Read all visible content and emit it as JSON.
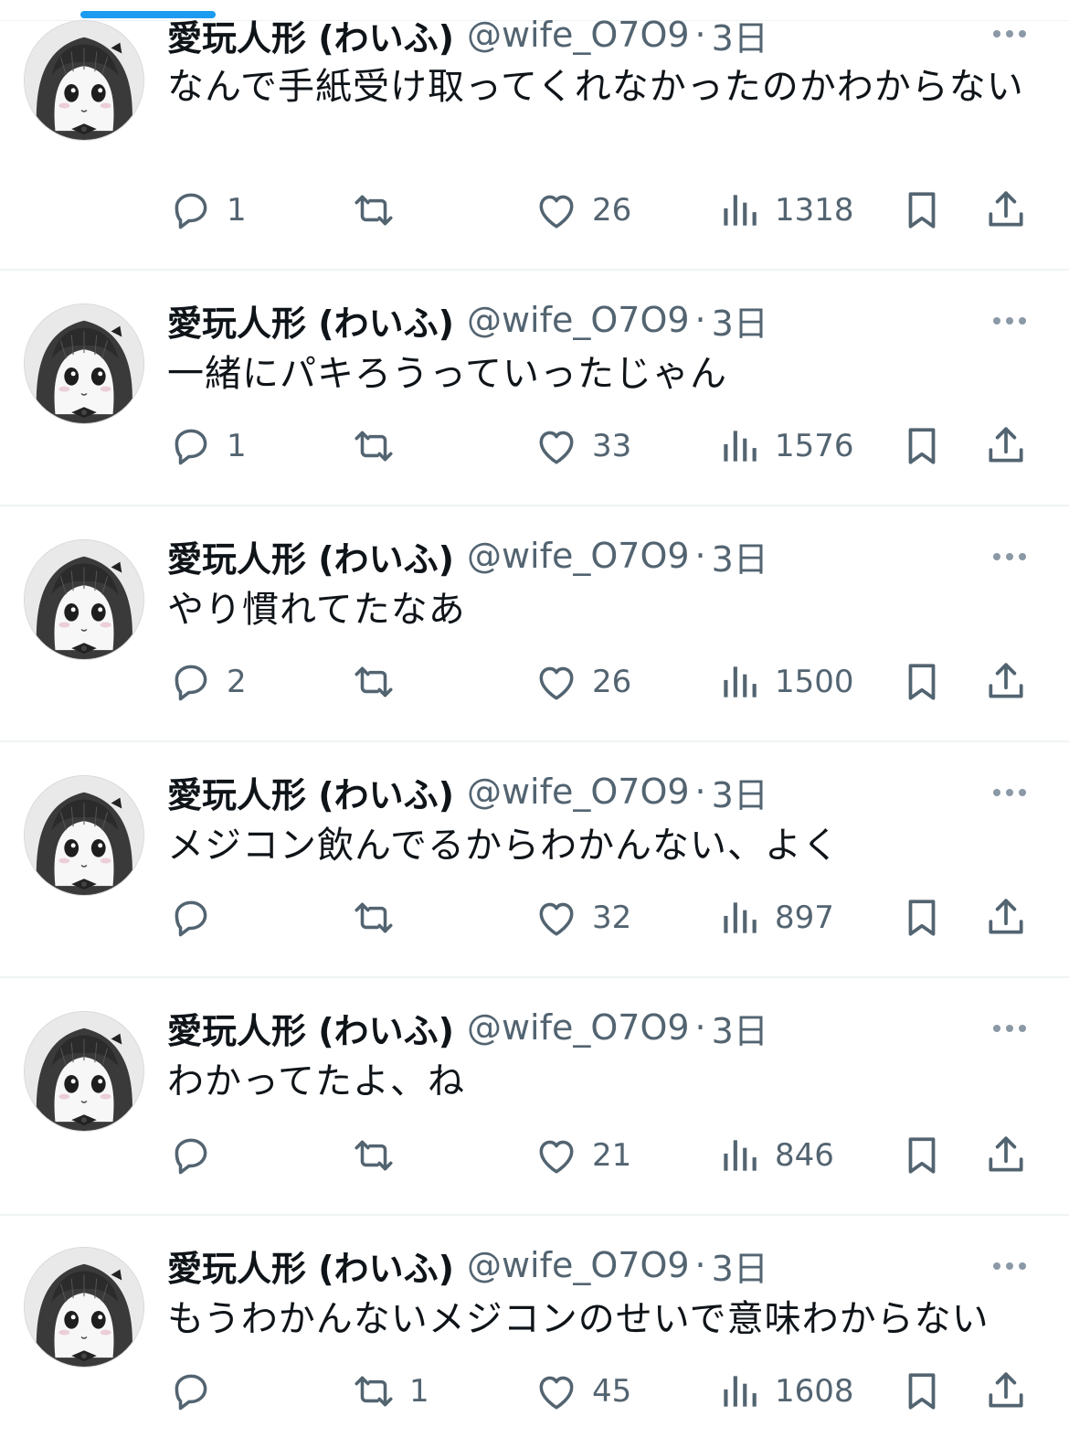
{
  "author": {
    "display_name": "愛玩人形 (わいふ)",
    "handle": "@wife_O7O9",
    "separator": "·",
    "time": "3日"
  },
  "tweets": [
    {
      "text": "なんで手紙受け取ってくれなかったのかわからない",
      "replies": "1",
      "retweets": "",
      "likes": "26",
      "views": "1318"
    },
    {
      "text": "一緒にパキろうっていったじゃん",
      "replies": "1",
      "retweets": "",
      "likes": "33",
      "views": "1576"
    },
    {
      "text": "やり慣れてたなあ",
      "replies": "2",
      "retweets": "",
      "likes": "26",
      "views": "1500"
    },
    {
      "text": "メジコン飲んでるからわかんない、よく",
      "replies": "",
      "retweets": "",
      "likes": "32",
      "views": "897"
    },
    {
      "text": "わかってたよ、ね",
      "replies": "",
      "retweets": "",
      "likes": "21",
      "views": "846"
    },
    {
      "text": "もうわかんないメジコンのせいで意味わからない",
      "replies": "",
      "retweets": "1",
      "likes": "45",
      "views": "1608"
    }
  ],
  "icons": {
    "reply": "reply-icon",
    "retweet": "retweet-icon",
    "like": "heart-icon",
    "views": "views-icon",
    "bookmark": "bookmark-icon",
    "share": "share-icon",
    "more": "more-icon"
  },
  "colors": {
    "accent": "#1d9bf0",
    "secondary_text": "#536471",
    "primary_text": "#0f1419",
    "divider": "#eff3f4"
  }
}
